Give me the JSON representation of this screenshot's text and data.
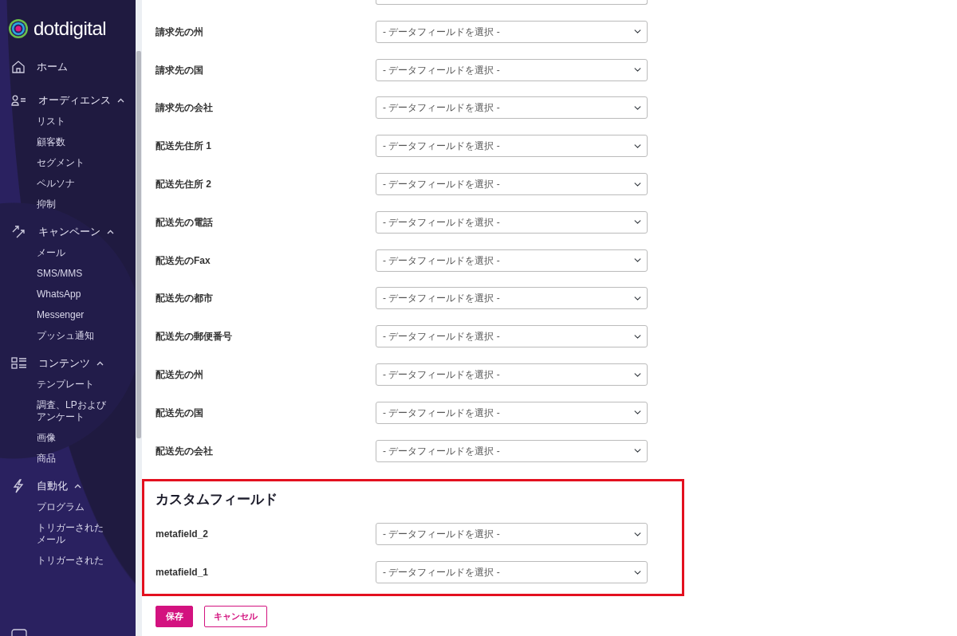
{
  "brand": "dotdigital",
  "nav": [
    {
      "label": "ホーム"
    },
    {
      "label": "オーディエンス",
      "expanded": true,
      "children": [
        "リスト",
        "顧客数",
        "セグメント",
        "ペルソナ",
        "抑制"
      ]
    },
    {
      "label": "キャンペーン",
      "expanded": true,
      "children": [
        "メール",
        "SMS/MMS",
        "WhatsApp",
        "Messenger",
        "プッシュ通知"
      ]
    },
    {
      "label": "コンテンツ",
      "expanded": true,
      "children": [
        "テンプレート",
        "調査、LPおよびアンケート",
        "画像",
        "商品"
      ]
    },
    {
      "label": "自動化",
      "expanded": true,
      "children": [
        "プログラム",
        "トリガーされたメール",
        "トリガーされた"
      ]
    }
  ],
  "fields": [
    {
      "label": "請求先の州",
      "value": "- データフィールドを選択 -"
    },
    {
      "label": "請求先の国",
      "value": "- データフィールドを選択 -"
    },
    {
      "label": "請求先の会社",
      "value": "- データフィールドを選択 -"
    },
    {
      "label": "配送先住所 1",
      "value": "- データフィールドを選択 -"
    },
    {
      "label": "配送先住所 2",
      "value": "- データフィールドを選択 -"
    },
    {
      "label": "配送先の電話",
      "value": "- データフィールドを選択 -"
    },
    {
      "label": "配送先のFax",
      "value": "- データフィールドを選択 -"
    },
    {
      "label": "配送先の都市",
      "value": "- データフィールドを選択 -"
    },
    {
      "label": "配送先の郵便番号",
      "value": "- データフィールドを選択 -"
    },
    {
      "label": "配送先の州",
      "value": "- データフィールドを選択 -"
    },
    {
      "label": "配送先の国",
      "value": "- データフィールドを選択 -"
    },
    {
      "label": "配送先の会社",
      "value": "- データフィールドを選択 -"
    }
  ],
  "custom_fields": {
    "title": "カスタムフィールド",
    "highlighted": true,
    "fields": [
      {
        "label": "metafield_2",
        "value": "- データフィールドを選択 -"
      },
      {
        "label": "metafield_1",
        "value": "- データフィールドを選択 -"
      }
    ]
  },
  "buttons": {
    "save": "保存",
    "cancel": "キャンセル"
  }
}
